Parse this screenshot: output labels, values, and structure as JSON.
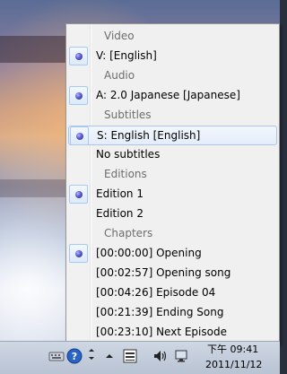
{
  "menu": {
    "sections": [
      {
        "header": "Video",
        "items": [
          {
            "label": "V: [English]",
            "checked": true,
            "hover": false
          }
        ]
      },
      {
        "header": "Audio",
        "items": [
          {
            "label": "A: 2.0 Japanese [Japanese]",
            "checked": true,
            "hover": false
          }
        ]
      },
      {
        "header": "Subtitles",
        "items": [
          {
            "label": "S: English [English]",
            "checked": true,
            "hover": true
          },
          {
            "label": "No subtitles",
            "checked": false,
            "hover": false
          }
        ]
      },
      {
        "header": "Editions",
        "items": [
          {
            "label": "Edition 1",
            "checked": true,
            "hover": false
          },
          {
            "label": "Edition 2",
            "checked": false,
            "hover": false
          }
        ]
      },
      {
        "header": "Chapters",
        "items": [
          {
            "label": "[00:00:00] Opening",
            "checked": true,
            "hover": false
          },
          {
            "label": "[00:02:57] Opening song",
            "checked": false,
            "hover": false
          },
          {
            "label": "[00:04:26] Episode 04",
            "checked": false,
            "hover": false
          },
          {
            "label": "[00:21:39] Ending Song",
            "checked": false,
            "hover": false
          },
          {
            "label": "[00:23:10] Next Episode",
            "checked": false,
            "hover": false
          }
        ]
      }
    ]
  },
  "taskbar": {
    "clock_time": "下午 09:41",
    "clock_date": "2011/11/12",
    "icons": [
      "keyboard-icon",
      "help-icon",
      "show-hidden-icons-icon",
      "flag-icon",
      "network-icon",
      "volume-icon",
      "action-center-icon"
    ]
  },
  "colors": {
    "menu_bg": "#f0f0f0",
    "header_text": "#6d6d6d",
    "hover_border": "#a9c6ef",
    "radio_dot": "#5a5ad0"
  }
}
